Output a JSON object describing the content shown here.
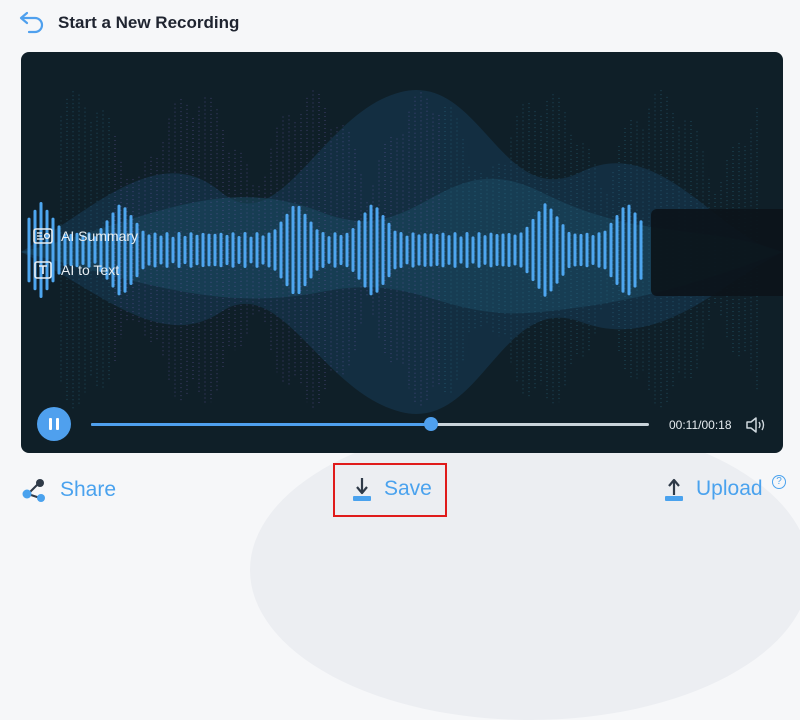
{
  "header": {
    "title": "Start a New Recording"
  },
  "ai_menu": {
    "summary_label": "AI Summary",
    "text_label": "AI to Text"
  },
  "player": {
    "elapsed": "00:11",
    "total": "00:18",
    "time_text": "00:11/00:18",
    "progress": 0.61
  },
  "actions": {
    "share_label": "Share",
    "save_label": "Save",
    "upload_label": "Upload",
    "help_glyph": "?"
  },
  "colors": {
    "accent": "#4fa0ee",
    "panel": "#0f1f28",
    "highlight": "#e01b1b"
  },
  "icons": {
    "back": "back-arrow-icon",
    "summary": "summary-card-icon",
    "text": "text-box-icon",
    "pause": "pause-icon",
    "volume": "volume-icon",
    "share": "share-icon",
    "save": "download-icon",
    "upload": "upload-icon",
    "help": "help-icon"
  }
}
